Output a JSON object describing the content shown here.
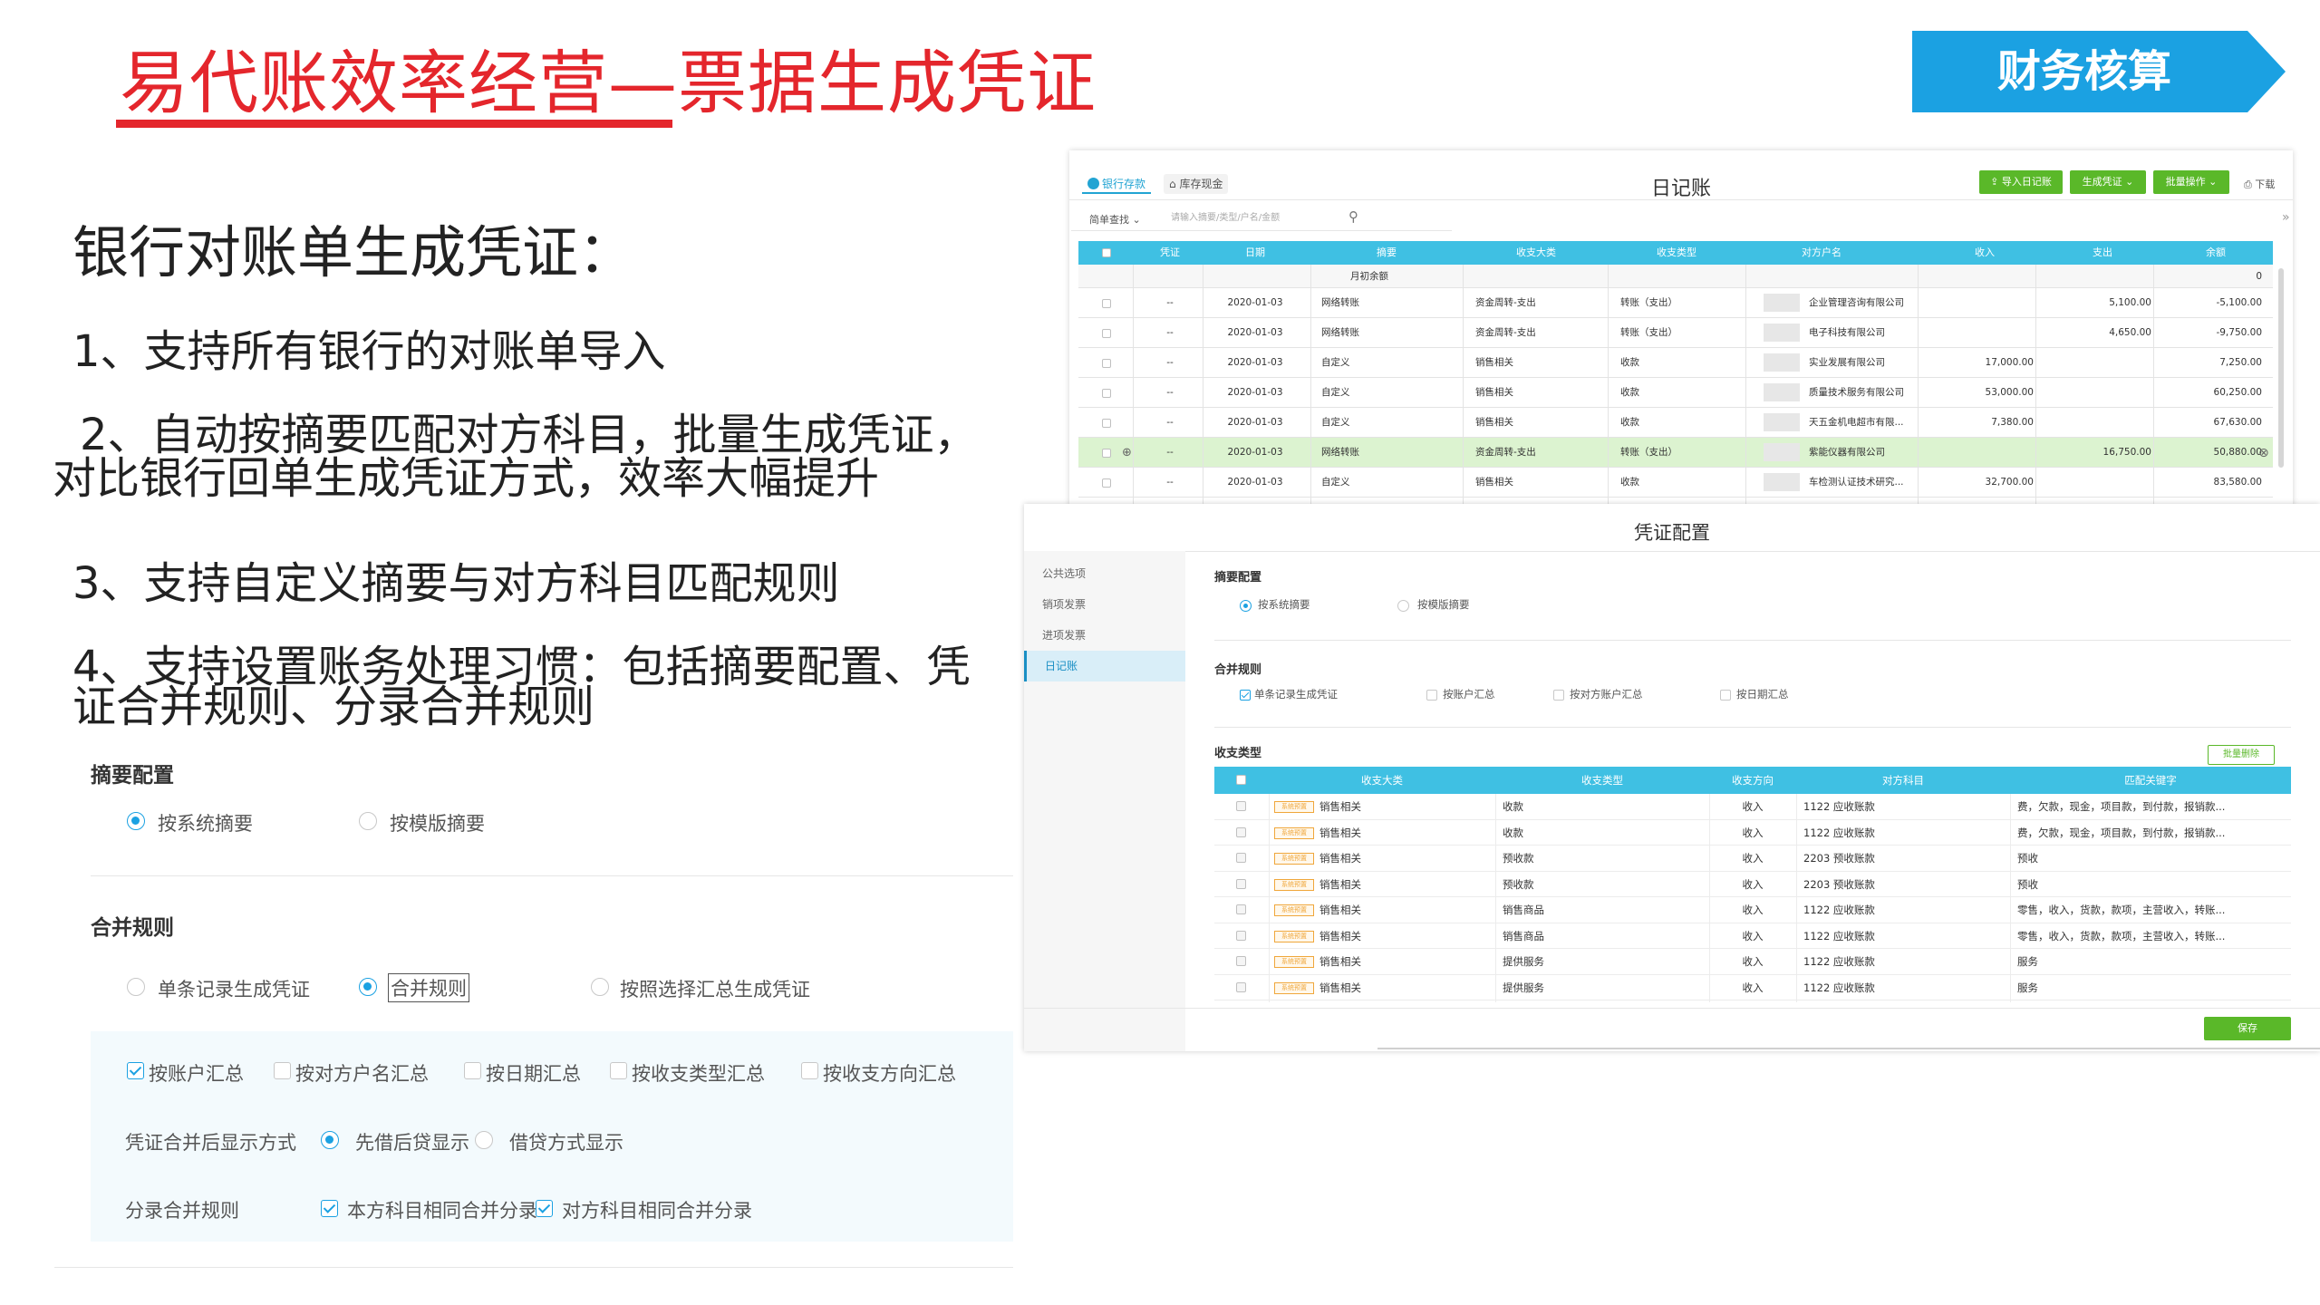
{
  "slide": {
    "title": "易代账效率经营—票据生成凭证",
    "banner": "财务核算",
    "heading": "银行对账单生成凭证：",
    "points": [
      "1、支持所有银行的对账单导入",
      "2、自动按摘要匹配对方科目，批量生成凭证，",
      "对比银行回单生成凭证方式，效率大幅提升",
      "3、支持自定义摘要与对方科目匹配规则",
      "4、支持设置账务处理习惯：包括摘要配置、凭",
      "证合并规则、分录合并规则"
    ]
  },
  "left_panel": {
    "summary_title": "摘要配置",
    "summary_options": [
      "按系统摘要",
      "按模版摘要"
    ],
    "summary_selected": 0,
    "merge_title": "合并规则",
    "merge_options": [
      "单条记录生成凭证",
      "合并规则",
      "按照选择汇总生成凭证"
    ],
    "merge_selected": 1,
    "summary_checks": [
      {
        "label": "按账户汇总",
        "checked": true
      },
      {
        "label": "按对方户名汇总",
        "checked": false
      },
      {
        "label": "按日期汇总",
        "checked": false
      },
      {
        "label": "按收支类型汇总",
        "checked": false
      },
      {
        "label": "按收支方向汇总",
        "checked": false
      }
    ],
    "display_label": "凭证合并后显示方式",
    "display_options": [
      "先借后贷显示",
      "借贷方式显示"
    ],
    "display_selected": 0,
    "entry_label": "分录合并规则",
    "entry_checks": [
      {
        "label": "本方科目相同合并分录",
        "checked": true
      },
      {
        "label": "对方科目相同合并分录",
        "checked": true
      }
    ]
  },
  "journal": {
    "tabs": [
      "银行存款",
      "库存现金"
    ],
    "title": "日记账",
    "buttons": [
      "导入日记账",
      "生成凭证",
      "批量操作"
    ],
    "download": "下载",
    "search_type": "简单查找",
    "search_placeholder": "请输入摘要/类型/户名/金额",
    "columns": [
      "凭证",
      "日期",
      "摘要",
      "收支大类",
      "收支类型",
      "对方户名",
      "收入",
      "支出",
      "余额"
    ],
    "opening_label": "月初余额",
    "opening_balance": "0",
    "rows": [
      {
        "voucher": "--",
        "date": "2020-01-03",
        "summary": "网络转账",
        "category": "资金周转-支出",
        "type": "转账（支出）",
        "party": "企业管理咨询有限公司",
        "income": "",
        "expense": "5,100.00",
        "balance": "-5,100.00"
      },
      {
        "voucher": "--",
        "date": "2020-01-03",
        "summary": "网络转账",
        "category": "资金周转-支出",
        "type": "转账（支出）",
        "party": "电子科技有限公司",
        "income": "",
        "expense": "4,650.00",
        "balance": "-9,750.00"
      },
      {
        "voucher": "--",
        "date": "2020-01-03",
        "summary": "自定义",
        "category": "销售相关",
        "type": "收款",
        "party": "实业发展有限公司",
        "income": "17,000.00",
        "expense": "",
        "balance": "7,250.00"
      },
      {
        "voucher": "--",
        "date": "2020-01-03",
        "summary": "自定义",
        "category": "销售相关",
        "type": "收款",
        "party": "质量技术服务有限公司",
        "income": "53,000.00",
        "expense": "",
        "balance": "60,250.00"
      },
      {
        "voucher": "--",
        "date": "2020-01-03",
        "summary": "自定义",
        "category": "销售相关",
        "type": "收款",
        "party": "天五金机电超市有限...",
        "income": "7,380.00",
        "expense": "",
        "balance": "67,630.00"
      },
      {
        "voucher": "--",
        "date": "2020-01-03",
        "summary": "网络转账",
        "category": "资金周转-支出",
        "type": "转账（支出）",
        "party": "紫能仪器有限公司",
        "income": "",
        "expense": "16,750.00",
        "balance": "50,880.00"
      },
      {
        "voucher": "--",
        "date": "2020-01-03",
        "summary": "自定义",
        "category": "销售相关",
        "type": "收款",
        "party": "车检测认证技术研究...",
        "income": "32,700.00",
        "expense": "",
        "balance": "83,580.00"
      }
    ],
    "highlight_row": 5
  },
  "config": {
    "title": "凭证配置",
    "sidebar": [
      "公共选项",
      "销项发票",
      "进项发票",
      "日记账"
    ],
    "sidebar_active": 3,
    "summary_title": "摘要配置",
    "summary_options": [
      "按系统摘要",
      "按模版摘要"
    ],
    "merge_title": "合并规则",
    "merge_checks": [
      {
        "label": "单条记录生成凭证",
        "checked": true
      },
      {
        "label": "按账户汇总",
        "checked": false
      },
      {
        "label": "按对方账户汇总",
        "checked": false
      },
      {
        "label": "按日期汇总",
        "checked": false
      }
    ],
    "types_title": "收支类型",
    "batch_delete": "批量删除",
    "columns": [
      "收支大类",
      "收支类型",
      "收支方向",
      "对方科目",
      "匹配关键字"
    ],
    "tag_text": "系统预置",
    "rows": [
      {
        "category": "销售相关",
        "type": "收款",
        "direction": "收入",
        "account": "1122 应收账款",
        "keywords": "费，欠款，现金，项目款，到付款，报销款..."
      },
      {
        "category": "销售相关",
        "type": "收款",
        "direction": "收入",
        "account": "1122 应收账款",
        "keywords": "费，欠款，现金，项目款，到付款，报销款..."
      },
      {
        "category": "销售相关",
        "type": "预收款",
        "direction": "收入",
        "account": "2203 预收账款",
        "keywords": "预收"
      },
      {
        "category": "销售相关",
        "type": "预收款",
        "direction": "收入",
        "account": "2203 预收账款",
        "keywords": "预收"
      },
      {
        "category": "销售相关",
        "type": "销售商品",
        "direction": "收入",
        "account": "1122 应收账款",
        "keywords": "零售，收入，货款，款项，主营收入，转账..."
      },
      {
        "category": "销售相关",
        "type": "销售商品",
        "direction": "收入",
        "account": "1122 应收账款",
        "keywords": "零售，收入，货款，款项，主营收入，转账..."
      },
      {
        "category": "销售相关",
        "type": "提供服务",
        "direction": "收入",
        "account": "1122 应收账款",
        "keywords": "服务"
      },
      {
        "category": "销售相关",
        "type": "提供服务",
        "direction": "收入",
        "account": "1122 应收账款",
        "keywords": "服务"
      }
    ],
    "save": "保存"
  },
  "colors": {
    "accent_red": "#e4262c",
    "banner_blue": "#1ba1e2",
    "table_header": "#3fc0e3",
    "button_green": "#5ab829"
  }
}
